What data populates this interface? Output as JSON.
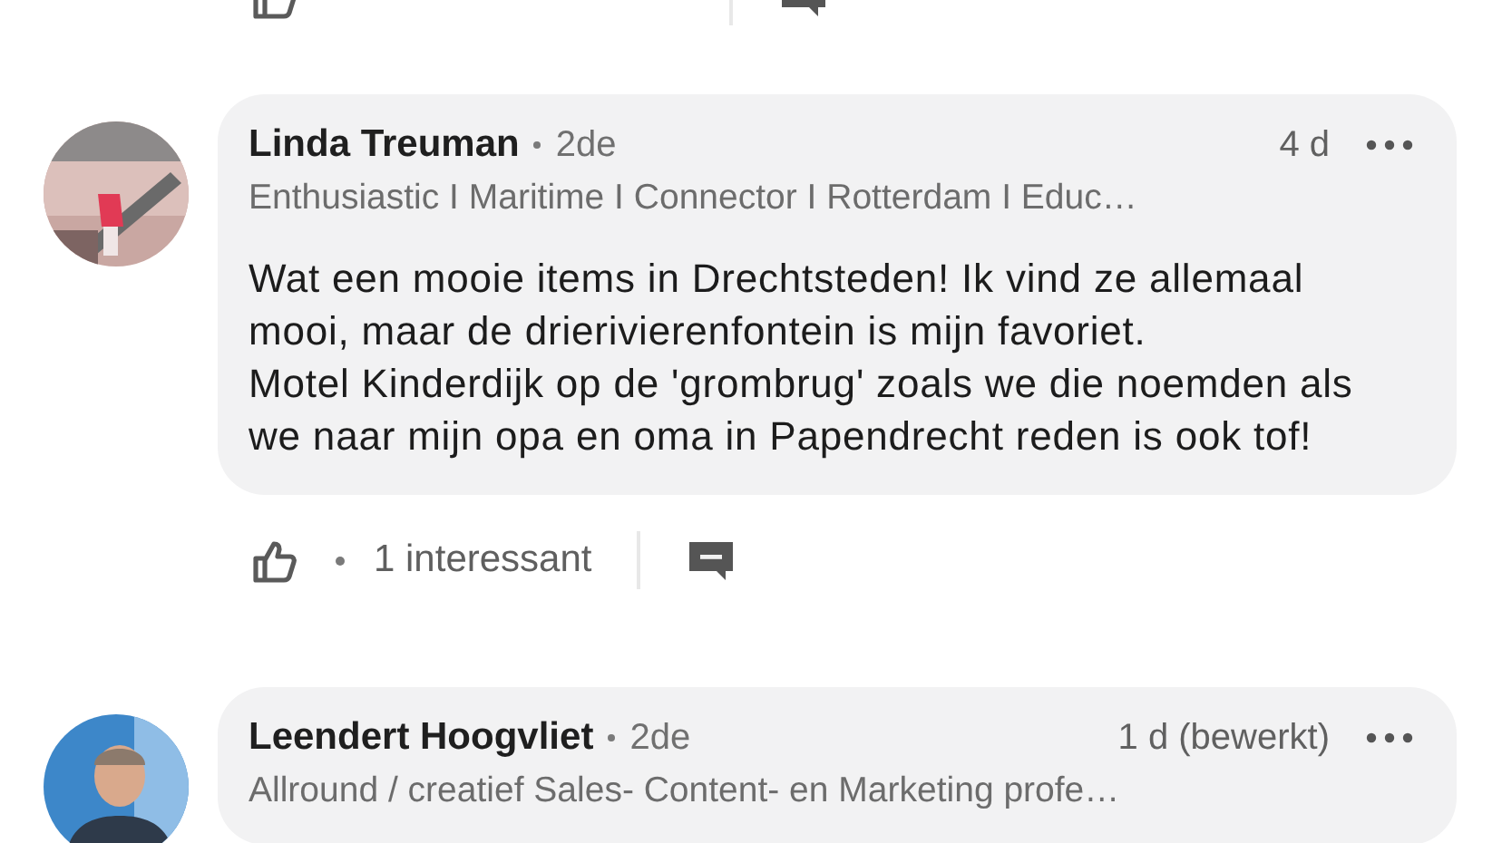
{
  "comments": [
    {
      "author": "Linda Treuman",
      "degree": "2de",
      "time": "4 d",
      "headline": "Enthusiastic I Maritime I Connector I Rotterdam I Educ…",
      "body": [
        "Wat een mooie items in Drechtsteden! Ik vind ze allemaal mooi, maar de drierivierenfontein is mijn favoriet.",
        "Motel Kinderdijk op de 'grombrug' zoals we die noemden als we naar mijn opa en oma in Papendrecht reden is ook tof!"
      ],
      "reaction_count": "1 interessant"
    },
    {
      "author": "Leendert Hoogvliet",
      "degree": "2de",
      "time": "1 d (bewerkt)",
      "headline": "Allround / creatief Sales- Content- en Marketing profe…"
    }
  ]
}
